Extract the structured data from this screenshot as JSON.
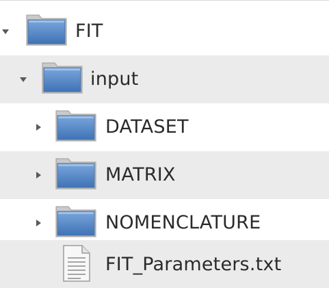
{
  "tree": {
    "rows": [
      {
        "label": "FIT",
        "type": "folder",
        "expanded": true,
        "toggle_icon": "triangle-down-icon",
        "icon": "folder-icon"
      },
      {
        "label": "input",
        "type": "folder",
        "expanded": true,
        "toggle_icon": "triangle-down-icon",
        "icon": "folder-icon"
      },
      {
        "label": "DATASET",
        "type": "folder",
        "expanded": false,
        "toggle_icon": "triangle-right-icon",
        "icon": "folder-icon"
      },
      {
        "label": "MATRIX",
        "type": "folder",
        "expanded": false,
        "toggle_icon": "triangle-right-icon",
        "icon": "folder-icon"
      },
      {
        "label": "NOMENCLATURE",
        "type": "folder",
        "expanded": false,
        "toggle_icon": "triangle-right-icon",
        "icon": "folder-icon"
      },
      {
        "label": "FIT_Parameters.txt",
        "type": "file",
        "icon": "text-file-icon"
      }
    ]
  },
  "colors": {
    "row_alt_background": "#ebebeb",
    "folder_blue": "#4a7fc0",
    "folder_light": "#a9c7ea",
    "toggle": "#5a5a5a",
    "text": "#2a2a2a"
  }
}
